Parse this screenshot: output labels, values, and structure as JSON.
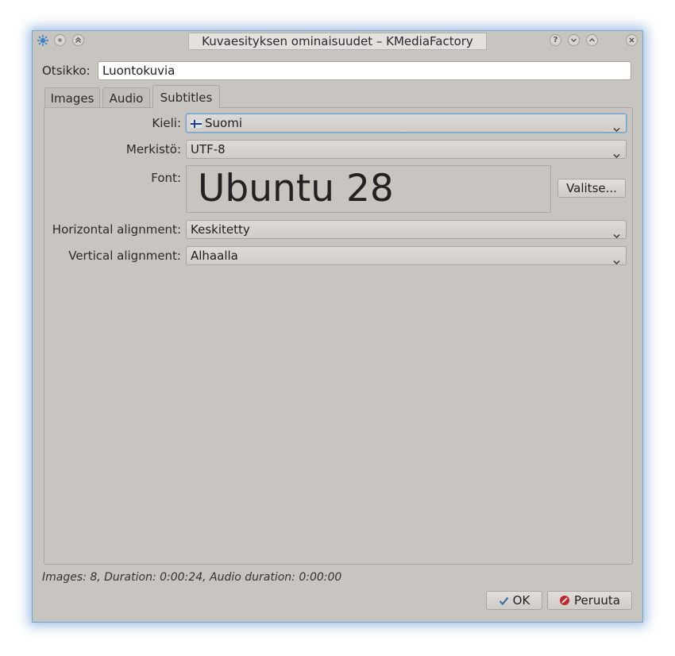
{
  "window": {
    "title": "Kuvaesityksen ominaisuudet – KMediaFactory"
  },
  "title_field": {
    "label": "Otsikko:",
    "value": "Luontokuvia"
  },
  "tabs": [
    {
      "label": "Images",
      "active": false
    },
    {
      "label": "Audio",
      "active": false
    },
    {
      "label": "Subtitles",
      "active": true
    }
  ],
  "subtitles": {
    "language": {
      "label": "Kieli:",
      "value": "Suomi"
    },
    "charset": {
      "label": "Merkistö:",
      "value": "UTF-8"
    },
    "font": {
      "label": "Font:",
      "preview": "Ubuntu 28",
      "choose_label": "Valitse..."
    },
    "horizontal": {
      "label": "Horizontal alignment:",
      "value": "Keskitetty"
    },
    "vertical": {
      "label": "Vertical alignment:",
      "value": "Alhaalla"
    }
  },
  "status": {
    "images_label": "Images:",
    "images_value": "8",
    "duration_label": "Duration:",
    "duration_value": "0:00:24",
    "audio_label": "Audio duration:",
    "audio_value": "0:00:00"
  },
  "buttons": {
    "ok": "OK",
    "cancel": "Peruuta"
  },
  "icons": {
    "app": "kde-gear-icon",
    "ok": "checkmark-icon",
    "cancel": "cancel-icon",
    "flag": "finland-flag-icon"
  },
  "colors": {
    "window_bg": "#c8c4c0",
    "focus": "#6fa6d3",
    "cancel_red": "#c0262b"
  }
}
